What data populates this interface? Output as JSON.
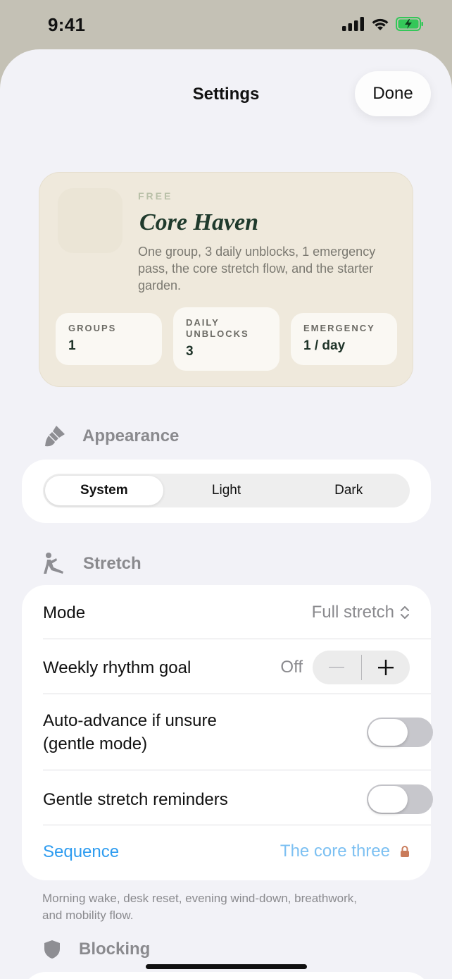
{
  "status_bar": {
    "time": "9:41"
  },
  "header": {
    "title": "Settings",
    "done_label": "Done"
  },
  "plan": {
    "tier": "FREE",
    "name": "Core Haven",
    "description": "One group, 3 daily unblocks, 1 emergency pass, the core stretch flow, and the starter garden.",
    "stats": [
      {
        "label": "GROUPS",
        "value": "1"
      },
      {
        "label": "DAILY UNBLOCKS",
        "value": "3"
      },
      {
        "label": "EMERGENCY",
        "value": "1 / day"
      }
    ]
  },
  "appearance": {
    "section_label": "Appearance",
    "options": [
      "System",
      "Light",
      "Dark"
    ],
    "selected": "System"
  },
  "stretch": {
    "section_label": "Stretch",
    "mode_label": "Mode",
    "mode_value": "Full stretch",
    "weekly_goal_label": "Weekly rhythm goal",
    "weekly_goal_value": "Off",
    "auto_advance_label_line1": "Auto-advance if unsure",
    "auto_advance_label_line2": "(gentle mode)",
    "auto_advance_on": false,
    "reminders_label": "Gentle stretch reminders",
    "reminders_on": false,
    "sequence_label": "Sequence",
    "sequence_value": "The core three",
    "footnote": "Morning wake, desk reset, evening wind-down, breathwork, and mobility flow."
  },
  "blocking": {
    "section_label": "Blocking"
  },
  "colors": {
    "accent_blue": "#2e9cf0",
    "lock_color": "#c97b5a",
    "plan_card_bg": "#efe9dc",
    "plan_name_color": "#1f3a2c"
  }
}
